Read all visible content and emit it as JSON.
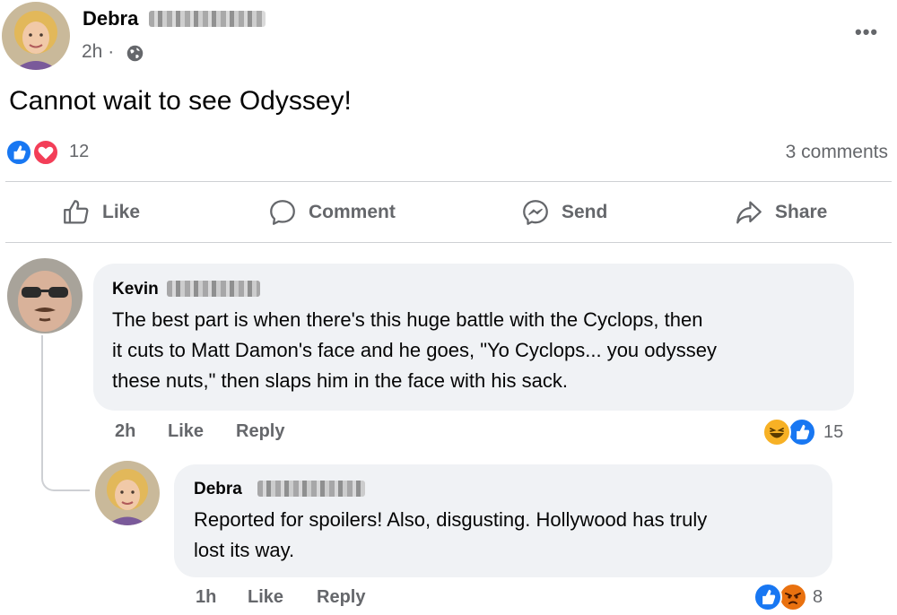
{
  "post": {
    "author_name": "Debra",
    "time": "2h ·",
    "text": "Cannot wait to see Odyssey!",
    "reaction_count": "12",
    "comment_count": "3 comments",
    "more_icon": "more-icon"
  },
  "actions": {
    "like": "Like",
    "comment": "Comment",
    "send": "Send",
    "share": "Share"
  },
  "comments": [
    {
      "author": "Kevin",
      "text_lines": [
        "The best part is when there's this huge battle with the Cyclops, then",
        "it cuts to Matt Damon's face and he goes, \"Yo Cyclops... you odyssey",
        "these nuts,\" then slaps him in the face with his sack."
      ],
      "time": "2h",
      "like_label": "Like",
      "reply_label": "Reply",
      "reaction_count": "15",
      "reactions": [
        "haha",
        "like"
      ]
    },
    {
      "author": "Debra",
      "text_lines": [
        "Reported for spoilers! Also, disgusting. Hollywood has truly",
        "lost its way."
      ],
      "time": "1h",
      "like_label": "Like",
      "reply_label": "Reply",
      "reaction_count": "8",
      "reactions": [
        "like",
        "angry"
      ]
    }
  ],
  "colors": {
    "like_blue": "#1877f2",
    "love_red": "#f33e58",
    "haha_yellow": "#f7b125",
    "angry_orange": "#e9710f",
    "secondary_text": "#65676b",
    "bubble_bg": "#f0f2f5"
  }
}
